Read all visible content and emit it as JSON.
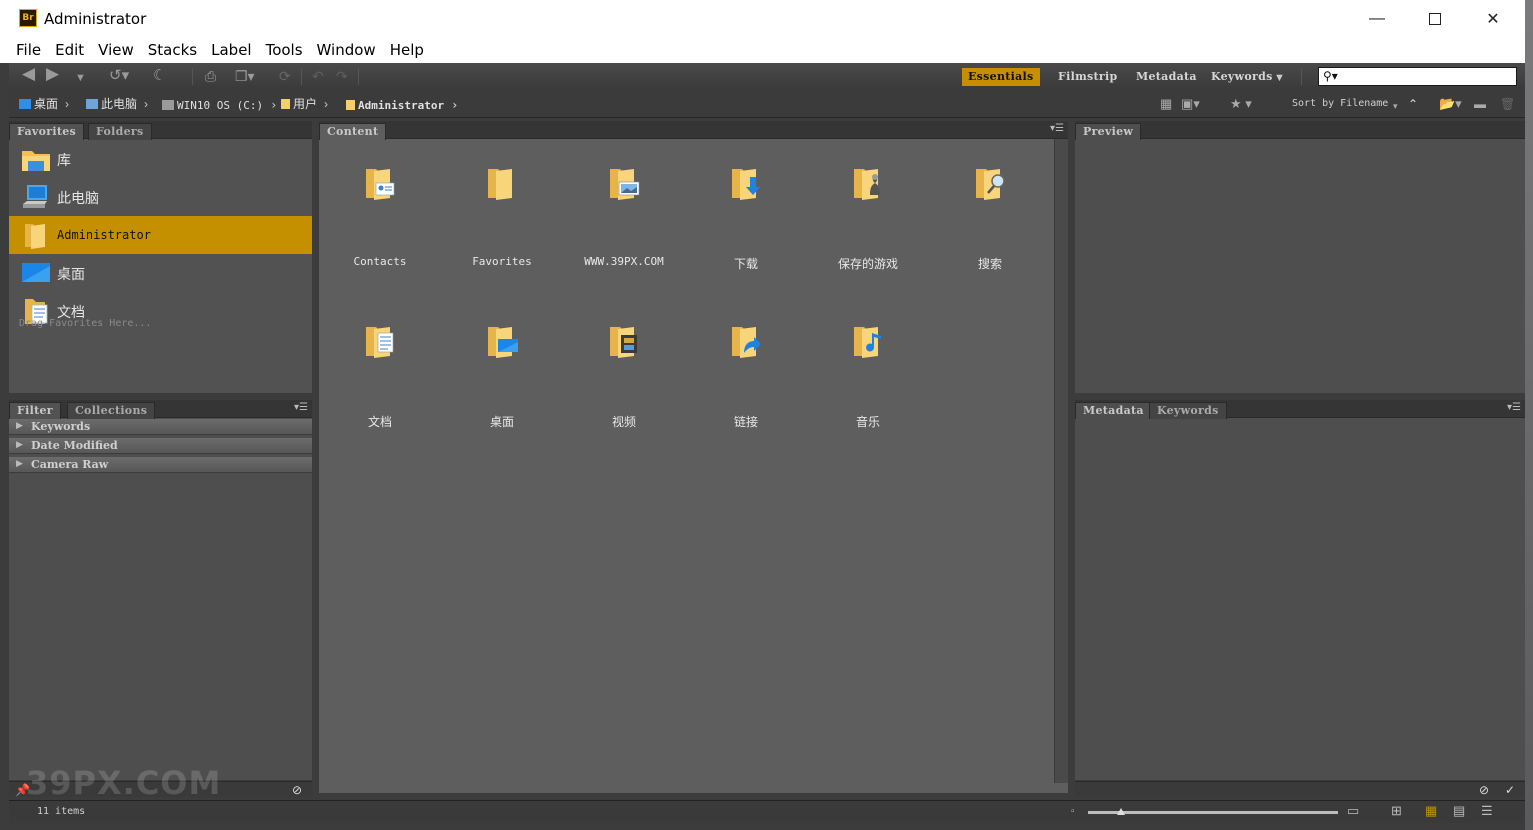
{
  "window": {
    "title": "Administrator",
    "app_logo": "Br",
    "controls": {
      "minimize": "—",
      "close": "✕"
    }
  },
  "menu": [
    "File",
    "Edit",
    "View",
    "Stacks",
    "Label",
    "Tools",
    "Window",
    "Help"
  ],
  "workspaces": [
    {
      "label": "Essentials",
      "active": true
    },
    {
      "label": "Filmstrip",
      "active": false
    },
    {
      "label": "Metadata",
      "active": false
    },
    {
      "label": "Keywords",
      "active": false
    }
  ],
  "search": {
    "value": ""
  },
  "breadcrumb": [
    "桌面",
    "此电脑",
    "WIN10 OS (C:)",
    "用户",
    "Administrator"
  ],
  "sort": {
    "label": "Sort by Filename"
  },
  "left_top_tabs": [
    "Favorites",
    "Folders"
  ],
  "favorites": [
    {
      "label": "库",
      "icon": "library-folder-icon"
    },
    {
      "label": "此电脑",
      "icon": "computer-icon"
    },
    {
      "label": "Administrator",
      "icon": "user-folder-icon",
      "selected": true
    },
    {
      "label": "桌面",
      "icon": "desktop-icon"
    },
    {
      "label": "文档",
      "icon": "documents-folder-icon"
    }
  ],
  "drag_hint": "Drag Favorites Here...",
  "left_bottom_tabs": [
    "Filter",
    "Collections"
  ],
  "filters": [
    "Keywords",
    "Date Modified",
    "Camera Raw"
  ],
  "content_tab": "Content",
  "content_items": [
    {
      "label": "Contacts",
      "icon": "contacts-folder-icon"
    },
    {
      "label": "Favorites",
      "icon": "favorites-folder-icon"
    },
    {
      "label": "WWW.39PX.COM",
      "icon": "pictures-folder-icon"
    },
    {
      "label": "下载",
      "icon": "downloads-folder-icon"
    },
    {
      "label": "保存的游戏",
      "icon": "saved-games-folder-icon"
    },
    {
      "label": "搜索",
      "icon": "searches-folder-icon"
    },
    {
      "label": "文档",
      "icon": "documents-folder-icon"
    },
    {
      "label": "桌面",
      "icon": "desktop-folder-icon"
    },
    {
      "label": "视频",
      "icon": "videos-folder-icon"
    },
    {
      "label": "链接",
      "icon": "links-folder-icon"
    },
    {
      "label": "音乐",
      "icon": "music-folder-icon"
    }
  ],
  "preview_tab": "Preview",
  "right_bottom_tabs": [
    "Metadata",
    "Keywords"
  ],
  "status": {
    "items": "11 items",
    "thumbnail_size": 0.13
  },
  "watermark": "39PX.COM",
  "colors": {
    "accent": "#c59000",
    "panel": "#525252",
    "folder": "#f5cf6c"
  }
}
